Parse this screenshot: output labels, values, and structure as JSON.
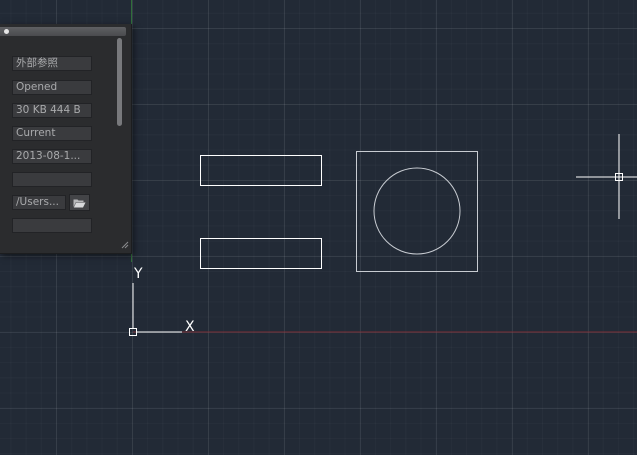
{
  "palette": {
    "fields": [
      {
        "key": "name",
        "value": "外部参照"
      },
      {
        "key": "status",
        "value": "Opened"
      },
      {
        "key": "size",
        "value": "30 KB 444 B"
      },
      {
        "key": "type",
        "value": "Current"
      },
      {
        "key": "date",
        "value": "2013-08-1..."
      },
      {
        "key": "blank1",
        "value": ""
      }
    ],
    "path": "/Users...",
    "blank2": "",
    "icons": {
      "grip": "grip-dot-icon",
      "folder": "folder-open-icon",
      "resize": "resize-grip-icon"
    }
  },
  "canvas": {
    "ucs": {
      "x_label": "X",
      "y_label": "Y"
    },
    "colors": {
      "background": "#222a36",
      "geometry": "#ffffff",
      "xref_geometry": "#c8ccd2",
      "x_axis": "#7a2e36",
      "y_axis": "#2f6f3a"
    }
  }
}
